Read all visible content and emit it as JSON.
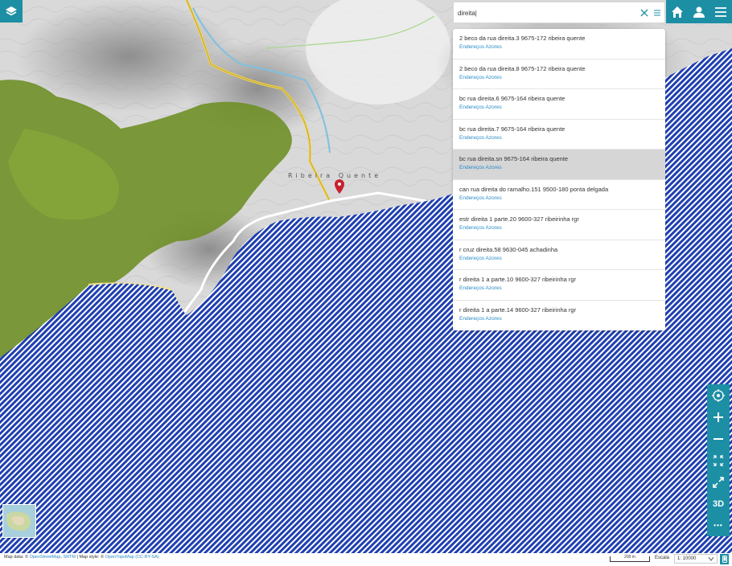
{
  "map": {
    "place_label": "Ribeira Quente",
    "sea_color": "#1f3fb0",
    "land_color": "#dcdcdc",
    "forest_color": "#6f8f27"
  },
  "search": {
    "value": "direita|",
    "results": [
      {
        "address": "2 beco da rua direita.3 9675-172 ribeira quente",
        "source": "Endereços Azores"
      },
      {
        "address": "2 beco da rua direita.8 9675-172 ribeira quente",
        "source": "Endereços Azores"
      },
      {
        "address": "bc rua direita.6 9675-164 ribeira quente",
        "source": "Endereços Azores"
      },
      {
        "address": "bc rua direita.7 9675-164 ribeira quente",
        "source": "Endereços Azores"
      },
      {
        "address": "bc rua direita.sn 9675-164 ribeira quente",
        "source": "Endereços Azores"
      },
      {
        "address": "can rua direita do ramalho.151 9500-180 ponta delgada",
        "source": "Endereços Azores"
      },
      {
        "address": "estr direita 1 parte.20 9600-327 ribeirinha rgr",
        "source": "Endereços Azores"
      },
      {
        "address": "r cruz direita.58 9630-045 achadinha",
        "source": "Endereços Azores"
      },
      {
        "address": "r direita 1 a parte.10 9600-327 ribeirinha rgr",
        "source": "Endereços Azores"
      },
      {
        "address": "r direita 1 a parte.14 9600-327 ribeirinha rgr",
        "source": "Endereços Azores"
      }
    ]
  },
  "toolbar": {
    "three_d_label": "3D",
    "more_label": "•••",
    "icons": [
      "locate-icon",
      "zoom-in-icon",
      "zoom-out-icon",
      "fullscreen-icon",
      "expand-icon",
      "3d",
      "more-icon"
    ]
  },
  "attribution": {
    "prefix": "Map data: ©",
    "osm": "OpenStreetMap",
    "sep1": ",",
    "srtm": "SRTM",
    "mid": "| Map style: ©",
    "otm": "OpenTopoMap",
    "license": "(CC-BY-SA)"
  },
  "scale": {
    "bar_label": "200 m",
    "escala_label": "Escala",
    "escala_value": "1: 10000"
  },
  "accent_color": "#1d8fa5"
}
